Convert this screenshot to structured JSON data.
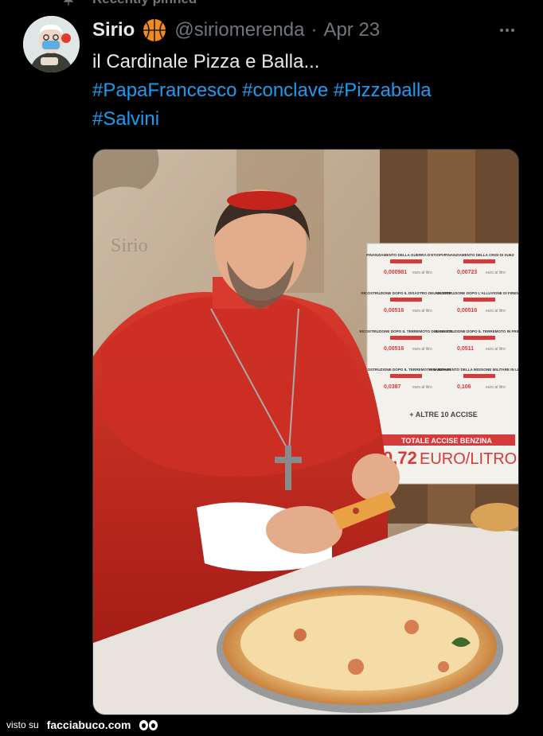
{
  "pinned_label": "Recently pinned",
  "tweet": {
    "name": "Sirio",
    "badge_icon": "basketball-icon",
    "handle": "@siriomerenda",
    "separator": "·",
    "date": "Apr 23",
    "text": "il Cardinale Pizza e Balla...",
    "hashtags_line1": [
      "#PapaFrancesco",
      "#conclave",
      "#Pizzaballa"
    ],
    "hashtags_line2": [
      "#Salvini"
    ]
  },
  "image": {
    "watermark": "Sirio",
    "board": {
      "labels": [
        "FINANZIAMENTO DELLA GUERRA D'ETIOPIA",
        "FINANZIAMENTO DELLA CRISI DI SUEZ",
        "RICOSTRUZIONE DOPO IL DISASTRO DEL VAJONT",
        "RICOSTRUZIONE DOPO L'ALLUVIONE DI FIRENZE",
        "RICOSTRUZIONE DOPO IL TERREMOTO DEL BELICE",
        "RICOSTRUZIONE DOPO IL TERREMOTO IN FRIULI",
        "RICOSTRUZIONE DOPO IL TERREMOTO IN IRPINIA",
        "FINANZIAMENTO DELLA MISSIONE MILITARE IN LIBANO"
      ],
      "values": [
        "0,000981",
        "0,00723",
        "0,00516",
        "0,00516",
        "0,00516",
        "0,0511",
        "0,0387",
        "0,106"
      ],
      "unit": "euro al litro",
      "more": "+ ALTRE 10 ACCISE",
      "total_label": "TOTALE ACCISE BENZINA",
      "total_value": "0,72",
      "total_unit": "EURO/LITRO"
    }
  },
  "footer": {
    "prefix": "visto su",
    "brand": "facciabuco.com"
  },
  "colors": {
    "background": "#000000",
    "text": "#e7e9ea",
    "muted": "#71767b",
    "link": "#1d9bf0",
    "cardinal_red": "#c8281f",
    "board_red": "#d63a3a"
  }
}
